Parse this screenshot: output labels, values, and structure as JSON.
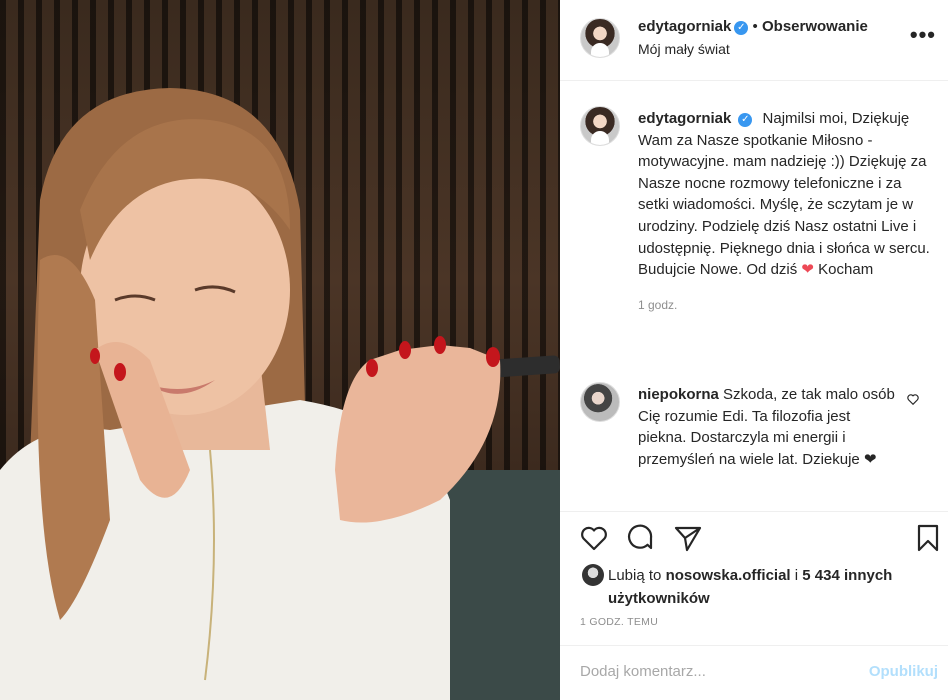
{
  "header": {
    "username": "edytagorniak",
    "separator": "•",
    "follow_label": "Obserwowanie",
    "location": "Mój mały świat",
    "more_label": "•••"
  },
  "caption": {
    "username": "edytagorniak",
    "text_before_heart": "Najmilsi moi, Dziękuję Wam za Nasze spotkanie Miłosno - motywacyjne. mam nadzieję :)) Dziękuję za Nasze nocne rozmowy telefoniczne i za setki wiadomości. Myślę, że sczytam je w urodziny. Podzielę dziś Nasz ostatni Live i udostępnię. Pięknego dnia i słońca w sercu. Budujcie Nowe. Od dziś",
    "heart": "❤",
    "text_after_heart": "Kocham",
    "time": "1 godz."
  },
  "comment": {
    "username": "niepokorna",
    "text": "Szkoda, ze tak malo osób Cię rozumie Edi. Ta filozofia jest piekna. Dostarczyla mi energii i przemyśleń na wiele lat. Dziekuje",
    "heart": "❤"
  },
  "likes": {
    "prefix": "Lubią to",
    "user": "nosowska.official",
    "conjunction": "i",
    "others": "5 434 innych użytkowników"
  },
  "post_time": "1 GODZ. TEMU",
  "comment_input": {
    "placeholder": "Dodaj komentarz..."
  },
  "publish_label": "Opublikuj",
  "colors": {
    "accent": "#3897f0",
    "heart": "#ed4956",
    "publish_disabled": "#b2dffc"
  }
}
